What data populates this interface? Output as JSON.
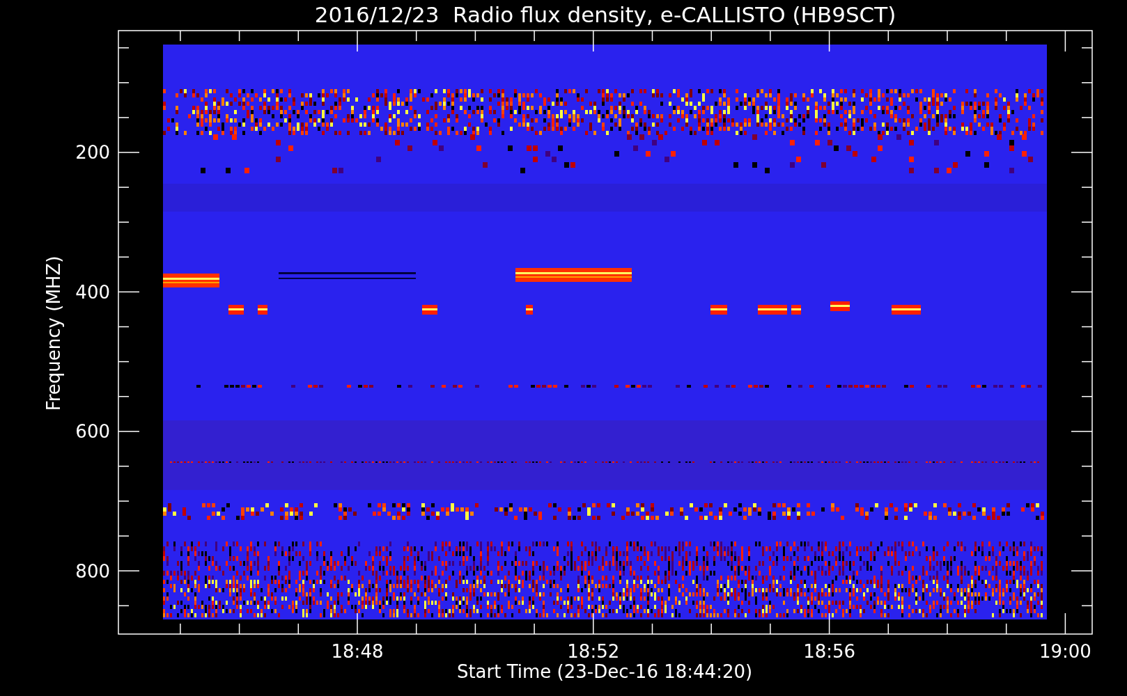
{
  "title": "2016/12/23  Radio flux density, e-CALLISTO (HB9SCT)",
  "y_axis": {
    "label": "Frequency (MHZ)",
    "ticks": [
      {
        "label": "200"
      },
      {
        "label": "400"
      },
      {
        "label": "600"
      },
      {
        "label": "800"
      }
    ]
  },
  "x_axis": {
    "label": "Start Time (23-Dec-16 18:44:20)",
    "ticks": [
      {
        "label": "18:48"
      },
      {
        "label": "18:52"
      },
      {
        "label": "18:56"
      },
      {
        "label": "19:00"
      }
    ]
  }
}
